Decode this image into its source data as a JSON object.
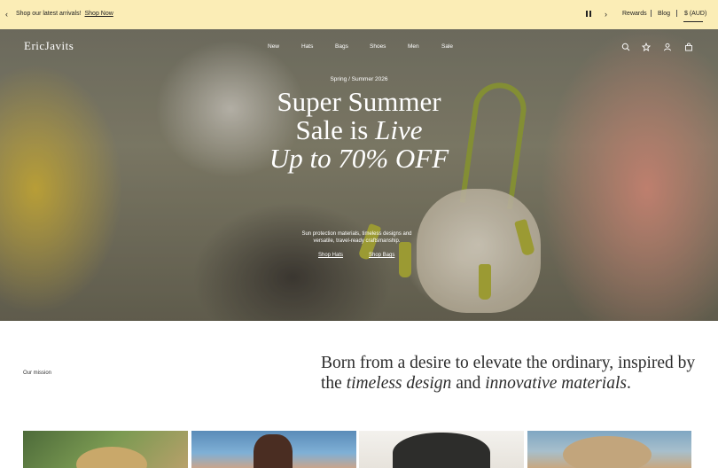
{
  "announcement": {
    "message": "Shop our latest arrivals!",
    "link": "Shop Now",
    "util_links": [
      "Rewards",
      "Blog",
      "$ (AUD)"
    ]
  },
  "header": {
    "logo": "EricJavits",
    "nav": [
      "New",
      "Hats",
      "Bags",
      "Shoes",
      "Men",
      "Sale"
    ],
    "icons": [
      "search-icon",
      "star-icon",
      "account-icon",
      "bag-icon"
    ]
  },
  "hero": {
    "eyebrow": "Spring / Summer 2026",
    "headline_line1": "Super Summer",
    "headline_line2_a": "Sale is",
    "headline_line2_b": "Live",
    "headline_line3": "Up to 70% OFF",
    "copy": "Sun protection materials, timeless designs and versatile, travel-ready craftsmanship.",
    "cta_hats": "Shop Hats",
    "cta_bags": "Shop Bags"
  },
  "mission": {
    "label": "Our mission",
    "text_a": "Born from a desire to elevate the ordinary, inspired by the",
    "text_b": "timeless design",
    "text_c": "and",
    "text_d": "innovative materials",
    "text_e": "."
  },
  "colors": {
    "announcement_bg": "#fbedb6",
    "text_dark": "#222222"
  }
}
